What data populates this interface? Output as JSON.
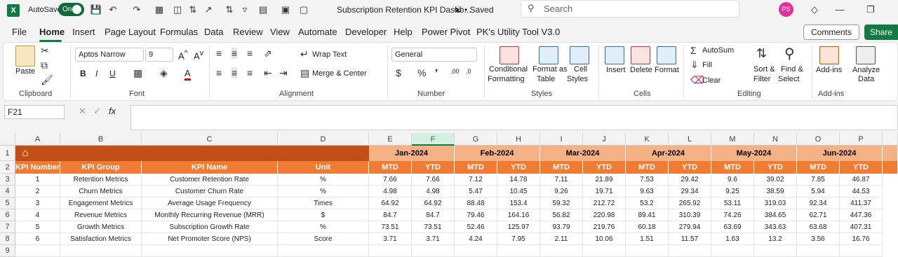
{
  "titlebar": {
    "autosave_label": "AutoSave",
    "autosave_state": "On",
    "doc_title": "Subscription Retention KPI Dashb...",
    "saved_status": "• Saved",
    "search_placeholder": "Search",
    "avatar_initials": "PS"
  },
  "menu": [
    "File",
    "Home",
    "Insert",
    "Page Layout",
    "Formulas",
    "Data",
    "Review",
    "View",
    "Automate",
    "Developer",
    "Help",
    "Power Pivot",
    "PK's Utility Tool V3.0"
  ],
  "menu_active": "Home",
  "buttons": {
    "comments": "Comments",
    "share": "Share"
  },
  "ribbon": {
    "paste": "Paste",
    "font_name": "Aptos Narrow",
    "font_size": "9",
    "wrap_text": "Wrap Text",
    "merge_center": "Merge & Center",
    "number_format": "General",
    "cond_format_1": "Conditional",
    "cond_format_2": "Formatting",
    "format_table_1": "Format as",
    "format_table_2": "Table",
    "cell_styles_1": "Cell",
    "cell_styles_2": "Styles",
    "insert": "Insert",
    "delete": "Delete",
    "format": "Format",
    "autosum": "AutoSum",
    "fill": "Fill",
    "clear": "Clear",
    "sort_1": "Sort &",
    "sort_2": "Filter",
    "find_1": "Find &",
    "find_2": "Select",
    "addins": "Add-ins",
    "analyze_1": "Analyze",
    "analyze_2": "Data",
    "groups": {
      "clipboard": "Clipboard",
      "font": "Font",
      "alignment": "Alignment",
      "number": "Number",
      "styles": "Styles",
      "cells": "Cells",
      "editing": "Editing",
      "addins": "Add-ins"
    }
  },
  "formula_bar": {
    "name_box": "F21",
    "fx": "fx"
  },
  "columns": [
    "A",
    "B",
    "C",
    "D",
    "E",
    "F",
    "G",
    "H",
    "I",
    "J",
    "K",
    "L",
    "M",
    "N",
    "O",
    "P"
  ],
  "selected_column": "F",
  "rows": [
    "1",
    "2",
    "3",
    "4",
    "5",
    "6",
    "7",
    "8",
    "9"
  ],
  "sheet": {
    "months": [
      "Jan-2024",
      "Feb-2024",
      "Mar-2024",
      "Apr-2024",
      "May-2024",
      "Jun-2024"
    ],
    "headers": [
      "KPI Number",
      "KPI Group",
      "KPI Name",
      "Unit"
    ],
    "mtd": "MTD",
    "ytd": "YTD",
    "data": [
      {
        "num": "1",
        "group": "Retention Metrics",
        "name": "Customer Retention Rate",
        "unit": "%",
        "vals": [
          "7.66",
          "7.66",
          "7.12",
          "14.78",
          "7.11",
          "21.89",
          "7.53",
          "29.42",
          "9.6",
          "39.02",
          "7.85",
          "46.87"
        ]
      },
      {
        "num": "2",
        "group": "Churn Metrics",
        "name": "Customer Churn Rate",
        "unit": "%",
        "vals": [
          "4.98",
          "4.98",
          "5.47",
          "10.45",
          "9.26",
          "19.71",
          "9.63",
          "29.34",
          "9.25",
          "38.59",
          "5.94",
          "44.53"
        ]
      },
      {
        "num": "3",
        "group": "Engagement Metrics",
        "name": "Average Usage Frequency",
        "unit": "Times",
        "vals": [
          "64.92",
          "64.92",
          "88.48",
          "153.4",
          "59.32",
          "212.72",
          "53.2",
          "265.92",
          "53.11",
          "319.03",
          "92.34",
          "411.37"
        ]
      },
      {
        "num": "4",
        "group": "Revenue Metrics",
        "name": "Monthly Recurring Revenue (MRR)",
        "unit": "$",
        "vals": [
          "84.7",
          "84.7",
          "79.46",
          "164.16",
          "56.82",
          "220.98",
          "89.41",
          "310.39",
          "74.26",
          "384.65",
          "62.71",
          "447.36"
        ]
      },
      {
        "num": "5",
        "group": "Growth Metrics",
        "name": "Subscription Growth Rate",
        "unit": "%",
        "vals": [
          "73.51",
          "73.51",
          "52.46",
          "125.97",
          "93.79",
          "219.76",
          "60.18",
          "279.94",
          "63.69",
          "343.63",
          "63.68",
          "407.31"
        ]
      },
      {
        "num": "6",
        "group": "Satisfaction Metrics",
        "name": "Net Promoter Score (NPS)",
        "unit": "Score",
        "vals": [
          "3.71",
          "3.71",
          "4.24",
          "7.95",
          "2.11",
          "10.06",
          "1.51",
          "11.57",
          "1.63",
          "13.2",
          "3.56",
          "16.76"
        ]
      }
    ]
  },
  "colors": {
    "band": "#c24f17",
    "month": "#f4b183",
    "header": "#f07c34",
    "accent": "#107c41"
  }
}
